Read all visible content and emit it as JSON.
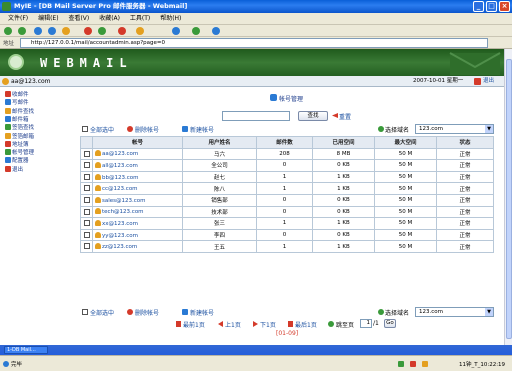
{
  "window": {
    "title": "MyIE - [DB Mail Server Pro 邮件服务器 - Webmail]",
    "address_label": "地址",
    "url": "http://127.0.0.1/mail/accountadmin.asp?page=0"
  },
  "menu": [
    "文件(F)",
    "编辑(E)",
    "查看(V)",
    "收藏(A)",
    "工具(T)",
    "帮助(H)"
  ],
  "banner": {
    "brand": "WEBMAIL"
  },
  "userbar": {
    "email": "aa@123.com",
    "datetime": "2007-10-01 星期一",
    "logout": "退出"
  },
  "sidebar": {
    "items": [
      {
        "label": "收邮件",
        "icon": "inbox-icon",
        "color": "#d43a2a"
      },
      {
        "label": "写邮件",
        "icon": "compose-icon",
        "color": "#2a7ad4"
      },
      {
        "label": "邮件查找",
        "icon": "search-icon",
        "color": "#e4a020"
      },
      {
        "label": "邮件箱",
        "icon": "mailbox-icon",
        "color": "#2a7ad4"
      },
      {
        "label": "签箔查找",
        "icon": "find-icon",
        "color": "#3a9a3a"
      },
      {
        "label": "签箔邮箱",
        "icon": "folder-icon",
        "color": "#e4a020"
      },
      {
        "label": "地址簿",
        "icon": "addressbook-icon",
        "color": "#d43a2a"
      },
      {
        "label": "帐号管理",
        "icon": "account-icon",
        "color": "#3a9a3a"
      },
      {
        "label": "配置器",
        "icon": "config-icon",
        "color": "#2a7ad4"
      },
      {
        "label": "退出",
        "icon": "exit-icon",
        "color": "#d43a2a"
      }
    ]
  },
  "main": {
    "title": "帐号管理",
    "search_value": "",
    "search_button": "查找",
    "reset_link": "重置",
    "select_all": "全部选中",
    "delete_account": "删除帐号",
    "new_account": "新建帐号",
    "domain_label": "选择域名",
    "domain_value": "123.com",
    "columns": [
      "帐号",
      "用户姓名",
      "邮件数",
      "已用空间",
      "最大空间",
      "状态"
    ],
    "rows": [
      {
        "account": "aa@123.com",
        "name": "马六",
        "count": "208",
        "used": "8 MB",
        "max": "50 M",
        "status": "正常"
      },
      {
        "account": "all@123.com",
        "name": "全公司",
        "count": "0",
        "used": "0 KB",
        "max": "50 M",
        "status": "正常"
      },
      {
        "account": "bb@123.com",
        "name": "赵七",
        "count": "1",
        "used": "1 KB",
        "max": "50 M",
        "status": "正常"
      },
      {
        "account": "cc@123.com",
        "name": "陈八",
        "count": "1",
        "used": "1 KB",
        "max": "50 M",
        "status": "正常"
      },
      {
        "account": "sales@123.com",
        "name": "销售部",
        "count": "0",
        "used": "0 KB",
        "max": "50 M",
        "status": "正常"
      },
      {
        "account": "tech@123.com",
        "name": "技术部",
        "count": "0",
        "used": "0 KB",
        "max": "50 M",
        "status": "正常"
      },
      {
        "account": "xx@123.com",
        "name": "张三",
        "count": "1",
        "used": "1 KB",
        "max": "50 M",
        "status": "正常"
      },
      {
        "account": "yy@123.com",
        "name": "李四",
        "count": "0",
        "used": "0 KB",
        "max": "50 M",
        "status": "正常"
      },
      {
        "account": "zz@123.com",
        "name": "王五",
        "count": "1",
        "used": "1 KB",
        "max": "50 M",
        "status": "正常"
      }
    ],
    "pager": {
      "first": "最前1页",
      "prev": "上1页",
      "next": "下1页",
      "last": "最后1页",
      "jump": "跳至页",
      "page_value": "1",
      "total": "/1",
      "go": "Go",
      "range": "[01-09]"
    }
  },
  "taskbar": {
    "tab": "1-DB Mail..."
  },
  "status": {
    "left": "完毕",
    "right": "11钟_T_10:22:19"
  }
}
